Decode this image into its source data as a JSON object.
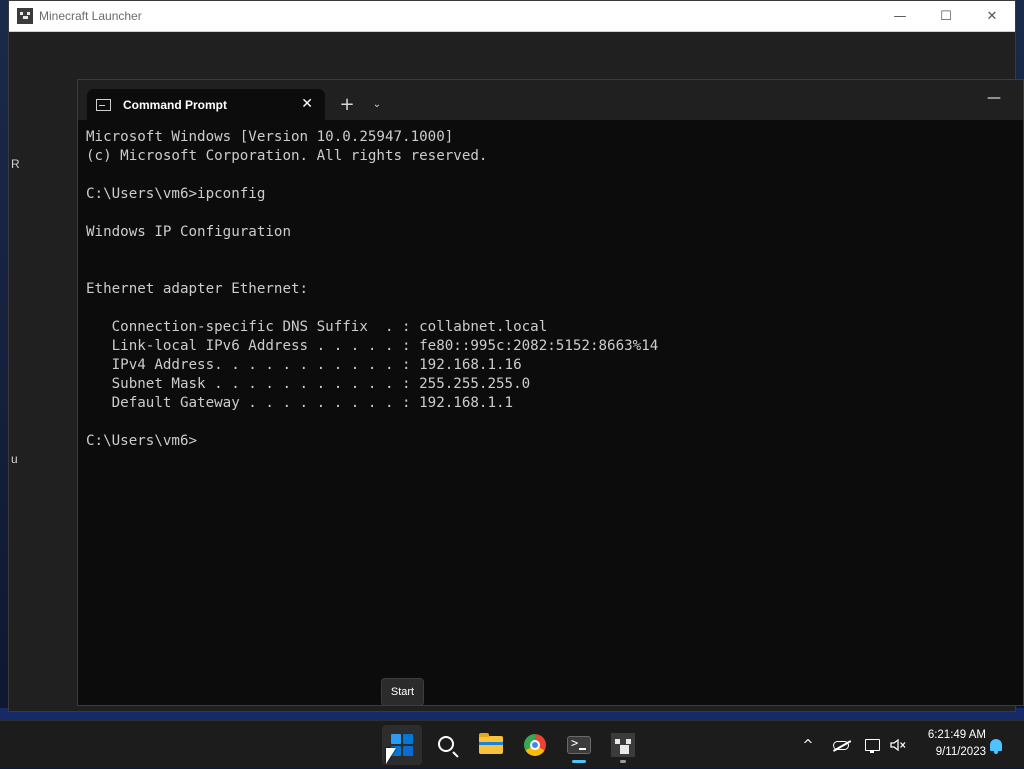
{
  "mc_window": {
    "title": "Minecraft Launcher",
    "minimize": "—",
    "maximize": "☐",
    "close": "✕",
    "edge_text_1": "R",
    "edge_text_2": "u"
  },
  "terminal": {
    "tab_title": "Command Prompt",
    "tab_close": "✕",
    "new_tab": "+",
    "dropdown": "⌄",
    "minimize": "—",
    "lines": [
      "Microsoft Windows [Version 10.0.25947.1000]",
      "(c) Microsoft Corporation. All rights reserved.",
      "",
      "C:\\Users\\vm6>ipconfig",
      "",
      "Windows IP Configuration",
      "",
      "",
      "Ethernet adapter Ethernet:",
      "",
      "   Connection-specific DNS Suffix  . : collabnet.local",
      "   Link-local IPv6 Address . . . . . : fe80::995c:2082:5152:8663%14",
      "   IPv4 Address. . . . . . . . . . . : 192.168.1.16",
      "   Subnet Mask . . . . . . . . . . . : 255.255.255.0",
      "   Default Gateway . . . . . . . . . : 192.168.1.1",
      "",
      "C:\\Users\\vm6>"
    ]
  },
  "tooltip": {
    "text": "Start"
  },
  "taskbar": {
    "apps": [
      {
        "name": "start",
        "icon": "windows-logo-icon"
      },
      {
        "name": "search",
        "icon": "search-icon"
      },
      {
        "name": "file-explorer",
        "icon": "folder-icon"
      },
      {
        "name": "chrome",
        "icon": "chrome-icon"
      },
      {
        "name": "terminal",
        "icon": "terminal-icon"
      },
      {
        "name": "minecraft",
        "icon": "minecraft-icon"
      }
    ],
    "tray": {
      "chevron": "^",
      "time": "6:21:49 AM",
      "date": "9/11/2023"
    }
  },
  "colors": {
    "accent": "#4cc2ff",
    "terminal_bg": "#0c0c0c",
    "taskbar_bg": "#1c1c1c"
  }
}
